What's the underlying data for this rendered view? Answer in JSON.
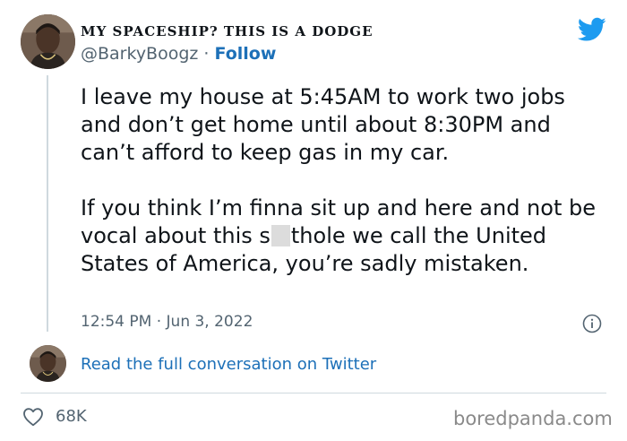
{
  "tweet": {
    "display_name": "MY SPACESHIP? THIS IS A DODGE",
    "handle": "@BarkyBoogz",
    "separator": " · ",
    "follow_label": "Follow",
    "paragraph_1": "I leave my house at 5:45AM to work two jobs and don’t get home until about 8:30PM and can’t afford to keep gas in my car.",
    "paragraph_2_before": "If you think I’m finna sit up and here and not be vocal about this s",
    "paragraph_2_after": "thole we call the United States of America, you’re sadly mistaken.",
    "timestamp": "12:54 PM · Jun 3, 2022"
  },
  "conversation": {
    "link_label": "Read the full conversation on Twitter"
  },
  "actions": {
    "like_count": "68K"
  },
  "watermark": {
    "text": "boredpanda.com"
  },
  "icons": {
    "logo": "twitter-bird-icon",
    "info": "info-icon",
    "like": "heart-icon"
  },
  "colors": {
    "brand": "#1d9bf0",
    "link": "#1d70b8",
    "secondary_text": "#536471",
    "divider": "#cfd9de"
  }
}
